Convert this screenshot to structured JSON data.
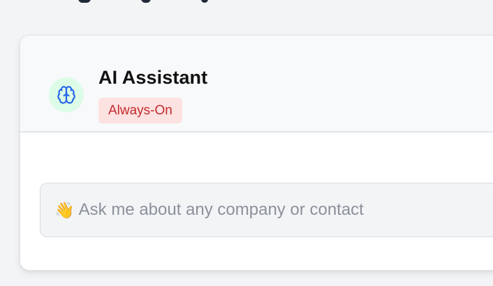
{
  "assistant": {
    "title": "AI Assistant",
    "status_badge": "Always-On",
    "avatar_icon": "brain-icon"
  },
  "chat": {
    "input_icon": "waving-hand-icon",
    "input_emoji": "👋",
    "input_placeholder": "Ask me about any company or contact",
    "input_value": ""
  },
  "colors": {
    "avatar_bg": "#dcfce7",
    "brain_icon": "#2563eb",
    "badge_bg": "#fde2e2",
    "badge_text": "#c42b2b"
  }
}
